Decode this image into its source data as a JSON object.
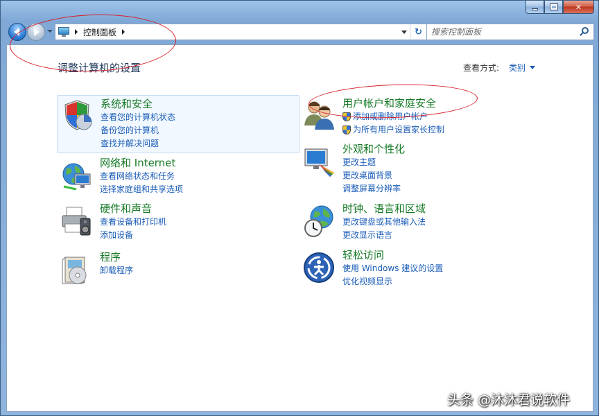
{
  "address_bar": {
    "crumbs": [
      "控制面板"
    ]
  },
  "search": {
    "placeholder": "搜索控制面板"
  },
  "header": {
    "title": "调整计算机的设置",
    "view_by_label": "查看方式:",
    "view_by_value": "类别"
  },
  "categories": [
    {
      "title": "系统和安全",
      "links": [
        "查看您的计算机状态",
        "备份您的计算机",
        "查找并解决问题"
      ]
    },
    {
      "title": "网络和 Internet",
      "links": [
        "查看网络状态和任务",
        "选择家庭组和共享选项"
      ]
    },
    {
      "title": "硬件和声音",
      "links": [
        "查看设备和打印机",
        "添加设备"
      ]
    },
    {
      "title": "程序",
      "links": [
        "卸载程序"
      ]
    },
    {
      "title": "用户帐户和家庭安全",
      "links": [
        "添加或删除用户帐户",
        "为所有用户设置家长控制"
      ]
    },
    {
      "title": "外观和个性化",
      "links": [
        "更改主题",
        "更改桌面背景",
        "调整屏幕分辨率"
      ]
    },
    {
      "title": "时钟、语言和区域",
      "links": [
        "更改键盘或其他输入法",
        "更改显示语言"
      ]
    },
    {
      "title": "轻松访问",
      "links": [
        "使用 Windows 建议的设置",
        "优化视频显示"
      ]
    }
  ],
  "watermark": "头条 @沐沐君说软件",
  "colors": {
    "category_title": "#157a26",
    "link": "#1a5cb8",
    "annotation": "#d81f2a"
  },
  "icons": {
    "system_security": "shield-chart-icon",
    "network": "globe-network-icon",
    "hardware": "printer-speaker-icon",
    "programs": "program-box-icon",
    "user_accounts": "users-icon",
    "appearance": "monitor-palette-icon",
    "clock_region": "globe-clock-icon",
    "ease_of_access": "accessibility-icon"
  }
}
